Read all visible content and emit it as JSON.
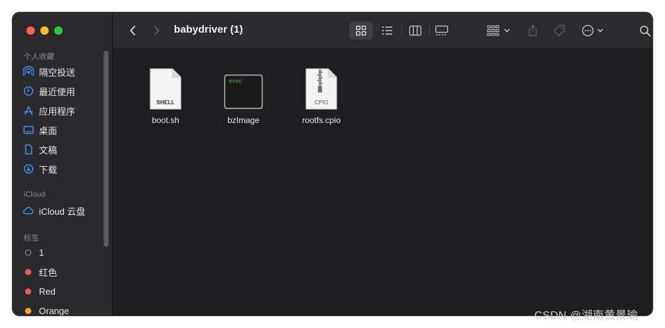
{
  "window": {
    "title": "babydriver (1)"
  },
  "sidebar": {
    "favorites_header": "个人收藏",
    "favorites": [
      {
        "label": "隔空投送",
        "icon": "airdrop-icon"
      },
      {
        "label": "最近使用",
        "icon": "clock-icon"
      },
      {
        "label": "应用程序",
        "icon": "applications-icon"
      },
      {
        "label": "桌面",
        "icon": "desktop-icon"
      },
      {
        "label": "文稿",
        "icon": "document-icon"
      },
      {
        "label": "下载",
        "icon": "download-icon"
      }
    ],
    "icloud_header": "iCloud",
    "icloud": [
      {
        "label": "iCloud 云盘",
        "icon": "cloud-icon"
      }
    ],
    "tags_header": "标签",
    "tags": [
      {
        "label": "1",
        "color": "none"
      },
      {
        "label": "红色",
        "color": "#ec5b57"
      },
      {
        "label": "Red",
        "color": "#ec5b57"
      },
      {
        "label": "Orange",
        "color": "#f5a623"
      }
    ]
  },
  "files": [
    {
      "name": "boot.sh",
      "icon": "shell-script-icon",
      "badge": "SHELL"
    },
    {
      "name": "bzImage",
      "icon": "executable-icon",
      "badge": "exec"
    },
    {
      "name": "rootfs.cpio",
      "icon": "archive-icon",
      "badge": "CPIO"
    }
  ],
  "watermark": "CSDN @湖南黄景瑜"
}
